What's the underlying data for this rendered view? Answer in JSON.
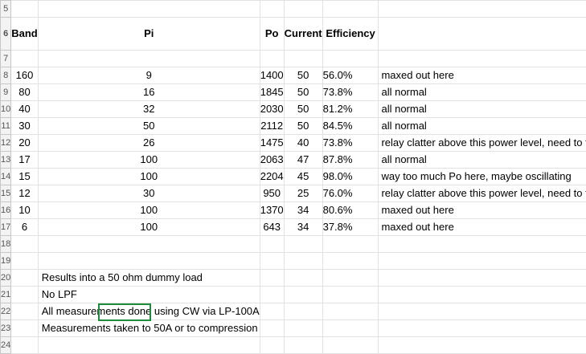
{
  "row_numbers": [
    "5",
    "6",
    "7",
    "8",
    "9",
    "10",
    "11",
    "12",
    "13",
    "14",
    "15",
    "16",
    "17",
    "18",
    "19",
    "20",
    "21",
    "22",
    "23",
    "24"
  ],
  "headers": {
    "band": "Band",
    "pi": "Pi",
    "po": "Po",
    "current": "Current",
    "efficiency": "Efficiency"
  },
  "rows": [
    {
      "band": "160",
      "pi": "9",
      "po": "1400",
      "current": "50",
      "efficiency": "56.0%",
      "note": "maxed out here"
    },
    {
      "band": "80",
      "pi": "16",
      "po": "1845",
      "current": "50",
      "efficiency": "73.8%",
      "note": "all normal"
    },
    {
      "band": "40",
      "pi": "32",
      "po": "2030",
      "current": "50",
      "efficiency": "81.2%",
      "note": "all normal"
    },
    {
      "band": "30",
      "pi": "50",
      "po": "2112",
      "current": "50",
      "efficiency": "84.5%",
      "note": "all normal"
    },
    {
      "band": "20",
      "pi": "26",
      "po": "1475",
      "current": "40",
      "efficiency": "73.8%",
      "note": "relay clatter above this power level, need to fix"
    },
    {
      "band": "17",
      "pi": "100",
      "po": "2063",
      "current": "47",
      "efficiency": "87.8%",
      "note": "all normal"
    },
    {
      "band": "15",
      "pi": "100",
      "po": "2204",
      "current": "45",
      "efficiency": "98.0%",
      "note": "way too much Po here, maybe oscillating"
    },
    {
      "band": "12",
      "pi": "30",
      "po": "950",
      "current": "25",
      "efficiency": "76.0%",
      "note": "relay clatter above this power level, need to fix"
    },
    {
      "band": "10",
      "pi": "100",
      "po": "1370",
      "current": "34",
      "efficiency": "80.6%",
      "note": "maxed out here"
    },
    {
      "band": "6",
      "pi": "100",
      "po": "643",
      "current": "34",
      "efficiency": "37.8%",
      "note": "maxed out here"
    }
  ],
  "notes": [
    "Results into a 50 ohm dummy load",
    "No LPF",
    "All measurements done using CW via LP-100A",
    "Measurements taken to 50A or to compression"
  ],
  "selection_color": "#1e8c3a"
}
